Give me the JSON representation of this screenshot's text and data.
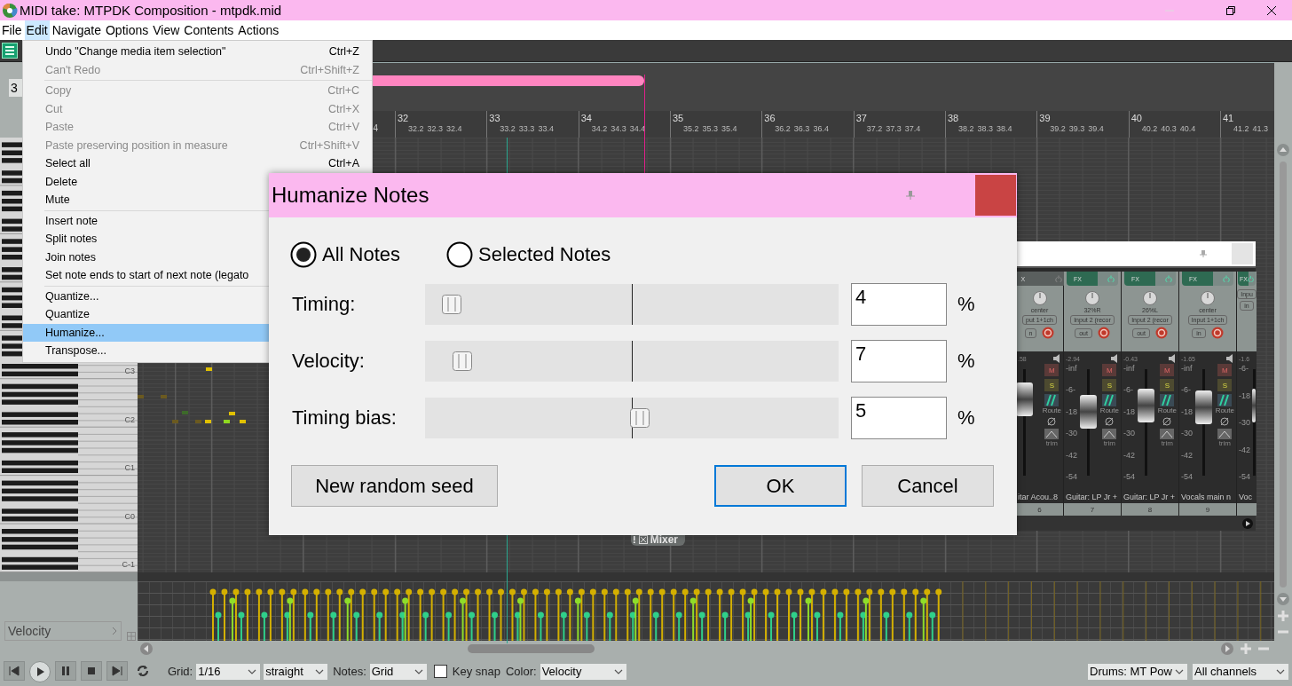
{
  "window": {
    "title": "MIDI take: MTPDK Composition - mtpdk.mid"
  },
  "menu_bar": [
    {
      "label": "File",
      "selected": false
    },
    {
      "label": "Edit",
      "selected": true
    },
    {
      "label": "Navigate",
      "selected": false
    },
    {
      "label": "Options",
      "selected": false
    },
    {
      "label": "View",
      "selected": false
    },
    {
      "label": "Contents",
      "selected": false
    },
    {
      "label": "Actions",
      "selected": false
    }
  ],
  "edit_menu": {
    "items": [
      {
        "kind": "item",
        "label": "Undo \"Change media item selection\"",
        "shortcut": "Ctrl+Z",
        "disabled": false,
        "selected": false
      },
      {
        "kind": "item",
        "label": "Can't Redo",
        "shortcut": "Ctrl+Shift+Z",
        "disabled": true,
        "selected": false
      },
      {
        "kind": "separator"
      },
      {
        "kind": "item",
        "label": "Copy",
        "shortcut": "Ctrl+C",
        "disabled": true,
        "selected": false
      },
      {
        "kind": "item",
        "label": "Cut",
        "shortcut": "Ctrl+X",
        "disabled": true,
        "selected": false
      },
      {
        "kind": "item",
        "label": "Paste",
        "shortcut": "Ctrl+V",
        "disabled": true,
        "selected": false
      },
      {
        "kind": "item",
        "label": "Paste preserving position in measure",
        "shortcut": "Ctrl+Shift+V",
        "disabled": true,
        "selected": false
      },
      {
        "kind": "item",
        "label": "Select all",
        "shortcut": "Ctrl+A",
        "disabled": false,
        "selected": false
      },
      {
        "kind": "item",
        "label": "Delete",
        "disabled": false,
        "selected": false
      },
      {
        "kind": "item",
        "label": "Mute",
        "disabled": false,
        "selected": false
      },
      {
        "kind": "separator"
      },
      {
        "kind": "item",
        "label": "Insert note",
        "disabled": false,
        "selected": false
      },
      {
        "kind": "item",
        "label": "Split notes",
        "disabled": false,
        "selected": false
      },
      {
        "kind": "item",
        "label": "Join notes",
        "disabled": false,
        "selected": false
      },
      {
        "kind": "item",
        "label": "Set note ends to start of next note (legato",
        "disabled": false,
        "selected": false
      },
      {
        "kind": "separator"
      },
      {
        "kind": "item",
        "label": "Quantize...",
        "disabled": false,
        "selected": false
      },
      {
        "kind": "item",
        "label": "Quantize",
        "disabled": false,
        "selected": false
      },
      {
        "kind": "item",
        "label": "Humanize...",
        "disabled": false,
        "selected": true
      },
      {
        "kind": "item",
        "label": "Transpose...",
        "disabled": false,
        "selected": false
      }
    ]
  },
  "position_field": "3",
  "ruler": {
    "lead": "4",
    "measures": [
      {
        "label": "32",
        "beats": [
          "32.2",
          "32.3",
          "32.4"
        ]
      },
      {
        "label": "33",
        "beats": [
          "33.2",
          "33.3",
          "33.4"
        ]
      },
      {
        "label": "34",
        "beats": [
          "34.2",
          "34.3",
          "34.4"
        ]
      },
      {
        "label": "35",
        "beats": [
          "35.2",
          "35.3",
          "35.4"
        ]
      },
      {
        "label": "36",
        "beats": [
          "36.2",
          "36.3",
          "36.4"
        ]
      },
      {
        "label": "37",
        "beats": [
          "37.2",
          "37.3",
          "37.4"
        ]
      },
      {
        "label": "38",
        "beats": [
          "38.2",
          "38.3",
          "38.4"
        ]
      },
      {
        "label": "39",
        "beats": [
          "39.2",
          "39.3",
          "39.4"
        ]
      },
      {
        "label": "40",
        "beats": [
          "40.2",
          "40.3",
          "40.4"
        ]
      },
      {
        "label": "41",
        "beats": [
          "41.2",
          "41.3"
        ]
      }
    ]
  },
  "piano": {
    "octave_labels": [
      "C3",
      "C2",
      "C1",
      "C0",
      "C-1"
    ]
  },
  "lane": {
    "label": "Velocity"
  },
  "dialog": {
    "title": "Humanize Notes",
    "scope": [
      {
        "label": "All Notes",
        "selected": true
      },
      {
        "label": "Selected Notes",
        "selected": false
      }
    ],
    "rows": [
      {
        "label": "Timing:",
        "level": 0.065,
        "value": "4",
        "unit": "%"
      },
      {
        "label": "Velocity:",
        "level": 0.09,
        "value": "7",
        "unit": "%"
      },
      {
        "label": "Timing bias:",
        "level": 0.52,
        "value": "5",
        "unit": "%"
      }
    ],
    "buttons": [
      {
        "label": "New random seed",
        "kind": "secondary"
      },
      {
        "label": "OK",
        "kind": "default"
      },
      {
        "label": "Cancel",
        "kind": "cancel"
      }
    ]
  },
  "mixer": {
    "tab_mark": "!",
    "tab_label": "Mixer",
    "strips": [
      {
        "fx": "X",
        "fx_on": false,
        "pan": "center",
        "input": "put 1+1ch",
        "io": "n",
        "peak": ".58",
        "mute": "M",
        "solo": "S",
        "route": "Route",
        "trim": "trim",
        "level": 0.72,
        "name": "itar Acou..8",
        "number": "6"
      },
      {
        "fx": "FX",
        "fx_on": true,
        "pan": "32%R",
        "input": "Input 2 (recor",
        "io": "out",
        "peak": "-2.94",
        "scale": [
          "-inf",
          "-6-",
          "-18",
          "-30",
          "-42",
          "-54"
        ],
        "mute": "M",
        "solo": "S",
        "route": "Route",
        "trim": "trim",
        "level": 0.6,
        "name": "Guitar: LP Jr +",
        "number": "7"
      },
      {
        "fx": "FX",
        "fx_on": true,
        "pan": "26%L",
        "input": "Input 2 (recor",
        "io": "out",
        "peak": "-0.43",
        "scale": [
          "-inf",
          "-6-",
          "-18",
          "-30",
          "-42",
          "-54"
        ],
        "mute": "M",
        "solo": "S",
        "route": "Route",
        "trim": "trim",
        "level": 0.66,
        "name": "Guitar: LP Jr +",
        "number": "8"
      },
      {
        "fx": "FX",
        "fx_on": true,
        "pan": "center",
        "input": "Input 1+1ch",
        "io": "in",
        "peak": "-1.65",
        "scale": [
          "-inf",
          "-6-",
          "-18",
          "-30",
          "-42",
          "-54"
        ],
        "mute": "M",
        "solo": "S",
        "route": "Route",
        "trim": "trim",
        "level": 0.64,
        "name": "Vocals main n",
        "number": "9"
      },
      {
        "fx": "FX",
        "fx_on": true,
        "input": "Inpu",
        "io": "in",
        "peak": "-1.6",
        "scale": [
          "-6-",
          "-18",
          "-30",
          "-42",
          "-54"
        ],
        "level": 0.66,
        "name": "Voc"
      }
    ]
  },
  "toolbar": {
    "grid_label": "Grid:",
    "grid": "1/16",
    "swing": "straight",
    "notes_label": "Notes:",
    "notes": "Grid",
    "key_snap": {
      "label": "Key snap",
      "checked": false
    },
    "color_label": "Color:",
    "color_mode": "Velocity",
    "track": "Drums: MT Pow",
    "channels": "All channels"
  }
}
